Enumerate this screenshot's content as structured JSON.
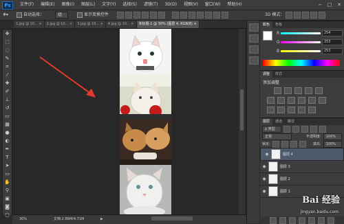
{
  "menubar": {
    "logo": "Ps",
    "items": [
      "文件(F)",
      "编辑(E)",
      "图像(I)",
      "图层(L)",
      "文字(Y)",
      "选择(S)",
      "滤镜(T)",
      "3D(D)",
      "视图(V)",
      "窗口(W)",
      "帮助(H)"
    ],
    "min": "−",
    "max": "□",
    "close": "✕"
  },
  "options": {
    "auto_select_label": "自动选择：",
    "auto_select_value": "组",
    "transform_label": "显示变换控件",
    "mode_3d": "3D 模式："
  },
  "tabs": [
    {
      "label": "1.jpg @ 10...",
      "close": "×",
      "active": false
    },
    {
      "label": "2.jpg @ 10...",
      "close": "×",
      "active": false
    },
    {
      "label": "3.jpg @ 10...",
      "close": "×",
      "active": false
    },
    {
      "label": "4.jpg @ 10...",
      "close": "×",
      "active": false
    },
    {
      "label": "未标题-1 @ 30% (图层 4, RGB/8)",
      "close": "×",
      "active": true
    }
  ],
  "status": {
    "zoom": "30%",
    "doc": "文档:2.86M/4.71M"
  },
  "color_panel": {
    "tabs": [
      "颜色",
      "色板"
    ],
    "channels": [
      {
        "label": "R",
        "value": "254"
      },
      {
        "label": "G",
        "value": "253"
      },
      {
        "label": "B",
        "value": "253"
      }
    ]
  },
  "adjust_panel": {
    "tabs": [
      "调整",
      "样式"
    ],
    "title": "添加调整"
  },
  "layers_panel": {
    "tabs": [
      "图层",
      "通道",
      "路径"
    ],
    "kind": "类型",
    "blend": "正常",
    "opacity_label": "不透明度:",
    "opacity": "100%",
    "lock_label": "锁定:",
    "fill_label": "填充:",
    "fill": "100%",
    "layers": [
      {
        "name": "图层 4",
        "selected": true
      },
      {
        "name": "图层 3",
        "selected": false
      },
      {
        "name": "图层 2",
        "selected": false
      },
      {
        "name": "图层 1",
        "selected": false
      }
    ]
  },
  "watermark": {
    "text": "Bai 经验",
    "url": "jingyan.baidu.com"
  },
  "colors": {
    "accent": "#4c5a6b",
    "arrow": "#e23a2f"
  }
}
